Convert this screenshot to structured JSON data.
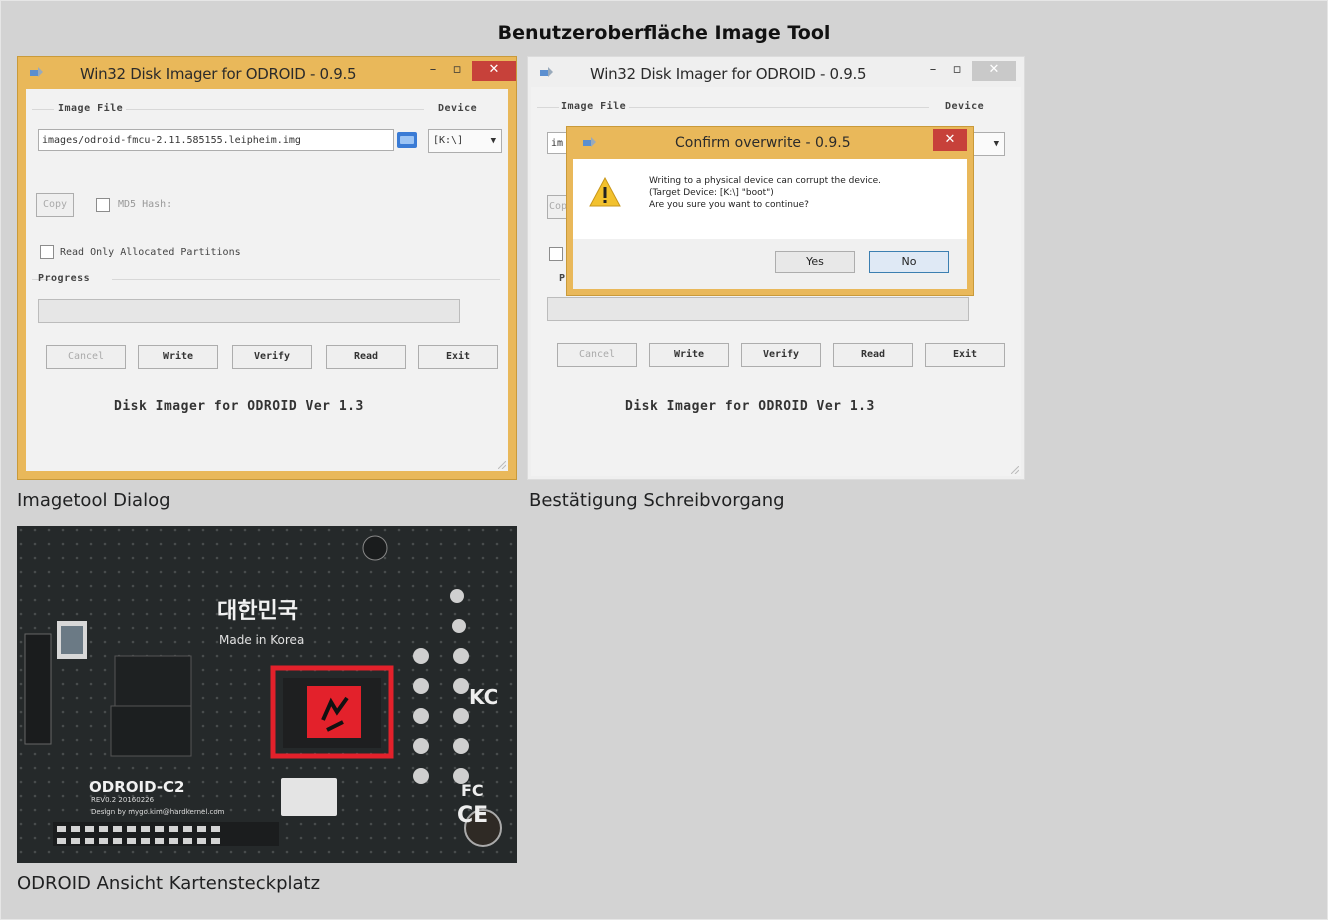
{
  "gallery": {
    "title": "Benutzeroberfläche Image Tool",
    "captions": [
      "Imagetool Dialog",
      "Bestätigung Schreibvorgang",
      "ODROID Ansicht Kartensteckplatz"
    ]
  },
  "imager": {
    "title": "Win32 Disk Imager for ODROID - 0.9.5",
    "minimize": "–",
    "maximize": "▫",
    "close": "✕",
    "image_file_label": "Image File",
    "device_label": "Device",
    "image_path": "images/odroid-fmcu-2.11.585155.leipheim.img",
    "device_value": "[K:\\]",
    "device_arrow": "▼",
    "copy_label": "Copy",
    "md5_label": "MD5 Hash:",
    "read_only_label": "Read Only Allocated Partitions",
    "progress_label": "Progress",
    "buttons": {
      "cancel": "Cancel",
      "write": "Write",
      "verify": "Verify",
      "read": "Read",
      "exit": "Exit"
    },
    "footer": "Disk Imager for ODROID Ver 1.3",
    "image_path_truncated": "im",
    "copy_truncated": "Cop",
    "progress_truncated": "P"
  },
  "confirm": {
    "title": "Confirm overwrite - 0.9.5",
    "close": "✕",
    "line1": "Writing to a physical device can corrupt the device.",
    "line2": "(Target Device: [K:\\] \"boot\")",
    "line3": "Are you sure you want to continue?",
    "yes": "Yes",
    "no": "No"
  },
  "board": {
    "korea_text": "대한민국",
    "made_in": "Made in Korea",
    "model": "ODROID-C2",
    "rev": "REV0.2 20160226",
    "design": "Design by mygo.kim@hardkernel.com",
    "cert_ce": "CE",
    "cert_fc": "FC",
    "cert_kc": "KC"
  },
  "colors": {
    "page_bg": "#d3d3d3",
    "active_frame": "#e9b85a",
    "close_red": "#c7413a",
    "highlight_red": "#e3212b"
  }
}
